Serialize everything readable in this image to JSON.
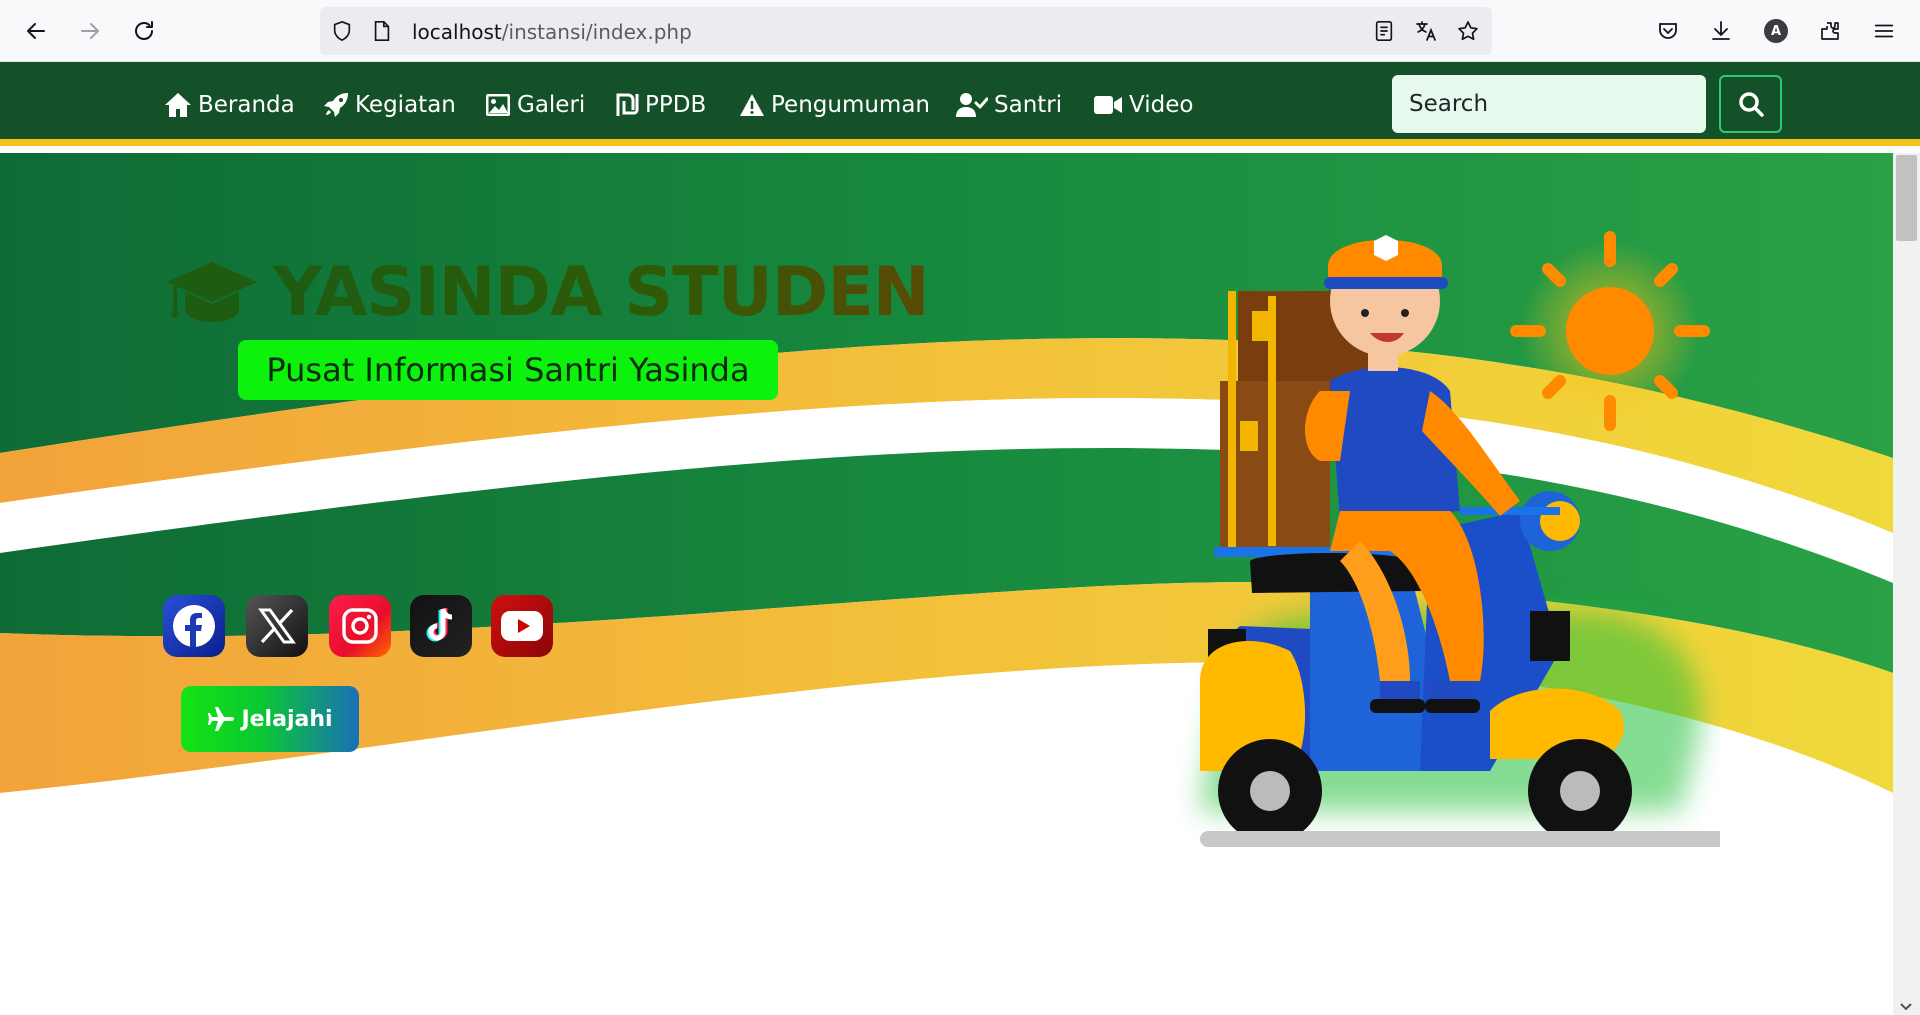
{
  "browser": {
    "url_host": "localhost",
    "url_path": "/instansi/index.php",
    "profile_initial": "A"
  },
  "navbar": {
    "items": [
      {
        "label": "Beranda",
        "icon": "home-icon"
      },
      {
        "label": "Kegiatan",
        "icon": "rocket-icon"
      },
      {
        "label": "Galeri",
        "icon": "image-icon"
      },
      {
        "label": "PPDB",
        "icon": "shekel-icon"
      },
      {
        "label": "Pengumuman",
        "icon": "warning-icon"
      },
      {
        "label": "Santri",
        "icon": "user-check-icon"
      },
      {
        "label": "Video",
        "icon": "video-icon"
      }
    ],
    "search_placeholder": "Search",
    "colors": {
      "background": "#145028",
      "border": "#f2c21b"
    }
  },
  "hero": {
    "title": "YASINDA STUDEN",
    "subtitle": "Pusat Informasi Santri Yasinda",
    "socials": [
      {
        "icon": "facebook-icon",
        "color": "#1877f2"
      },
      {
        "icon": "x-icon",
        "color": "#111111"
      },
      {
        "icon": "instagram-icon",
        "color": "#e4405f"
      },
      {
        "icon": "tiktok-icon",
        "color": "#000000"
      },
      {
        "icon": "youtube-icon",
        "color": "#c4302b"
      }
    ],
    "explore_label": "Jelajahi"
  }
}
